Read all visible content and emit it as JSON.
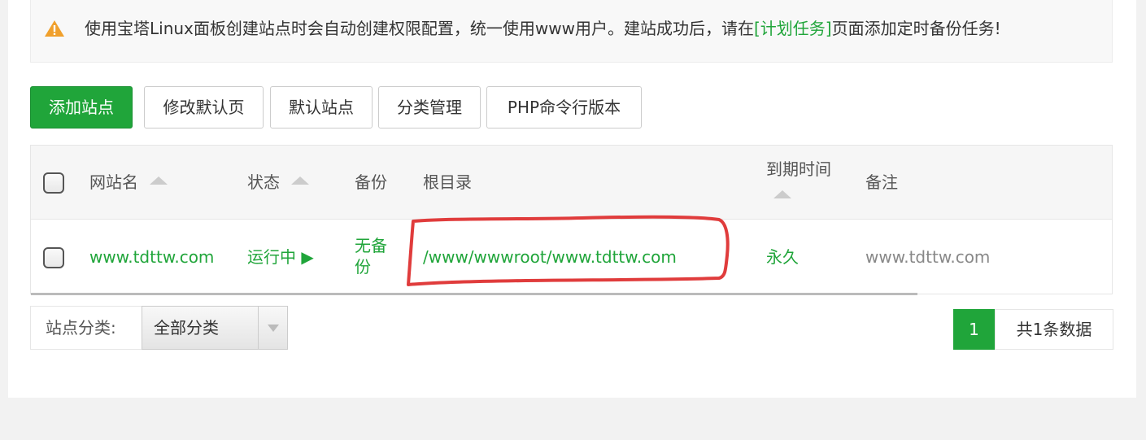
{
  "notice": {
    "text_before": "使用宝塔Linux面板创建站点时会自动创建权限配置，统一使用www用户。建站成功后，请在",
    "link": "[计划任务]",
    "text_after": "页面添加定时备份任务!",
    "icon": "warning-triangle-icon"
  },
  "toolbar": {
    "add_site": "添加站点",
    "edit_default_page": "修改默认页",
    "default_site": "默认站点",
    "category_manage": "分类管理",
    "php_cli_version": "PHP命令行版本"
  },
  "table": {
    "headers": {
      "site_name": "网站名",
      "status": "状态",
      "backup": "备份",
      "root_dir": "根目录",
      "expire_time": "到期时间",
      "remark": "备注"
    },
    "rows": [
      {
        "site_name": "www.tdttw.com",
        "status": "运行中 ▶",
        "backup_line1": "无备",
        "backup_line2": "份",
        "root_dir": "/www/wwwroot/www.tdttw.com",
        "expire_time": "永久",
        "remark": "www.tdttw.com"
      }
    ]
  },
  "filter": {
    "label": "站点分类:",
    "selected": "全部分类"
  },
  "pagination": {
    "current_page": "1",
    "total": "共1条数据"
  },
  "colors": {
    "accent": "#20a53a",
    "annotation": "#e03c3c",
    "warning": "#f0a02c"
  }
}
